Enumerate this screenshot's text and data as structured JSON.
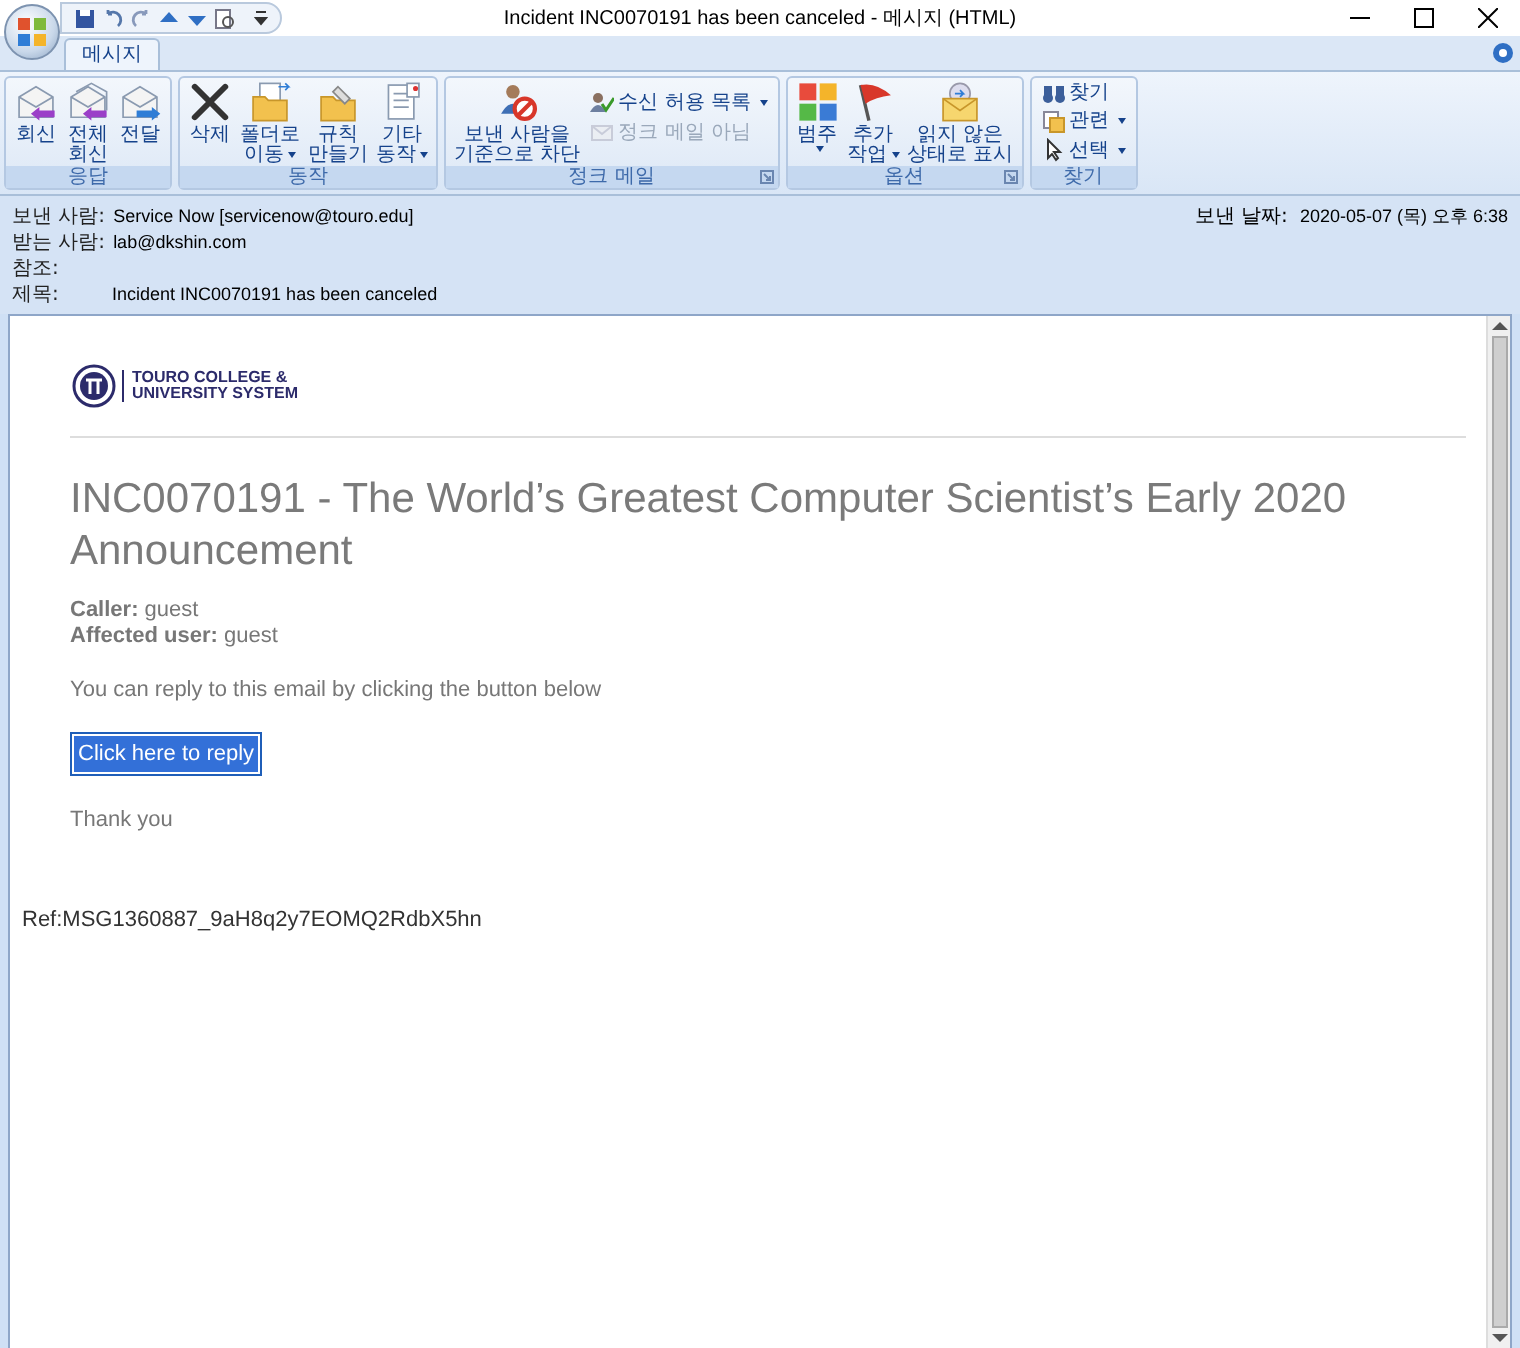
{
  "window": {
    "title": "Incident INC0070191 has been canceled - 메시지 (HTML)"
  },
  "quick_access": [
    {
      "kind": "save"
    },
    {
      "kind": "undo"
    },
    {
      "kind": "redo"
    },
    {
      "kind": "up"
    },
    {
      "kind": "down"
    },
    {
      "kind": "preview"
    }
  ],
  "tabs": [
    {
      "label": "메시지",
      "selected": true
    }
  ],
  "ribbon": [
    {
      "label": "응답",
      "buttons": [
        {
          "kind": "reply",
          "lines": [
            "회신"
          ]
        },
        {
          "kind": "replyall",
          "lines": [
            "전체",
            "회신"
          ]
        },
        {
          "kind": "forward",
          "lines": [
            "전달"
          ]
        }
      ]
    },
    {
      "label": "동작",
      "buttons": [
        {
          "kind": "delete",
          "lines": [
            "삭제"
          ]
        },
        {
          "kind": "move",
          "lines": [
            "폴더로",
            "이동"
          ],
          "dropdown": true
        },
        {
          "kind": "rule",
          "lines": [
            "규칙",
            "만들기"
          ]
        },
        {
          "kind": "other",
          "lines": [
            "기타",
            "동작"
          ],
          "dropdown": true
        }
      ]
    },
    {
      "label": "정크 메일",
      "launcher": true,
      "buttons": [
        {
          "kind": "block",
          "lines": [
            "보낸 사람을",
            "기준으로 차단"
          ]
        }
      ],
      "small": [
        {
          "kind": "safe",
          "label": "수신 허용 목록",
          "dropdown": true,
          "disabled": false
        },
        {
          "kind": "notjunk",
          "label": "정크 메일 아님",
          "disabled": true
        }
      ]
    },
    {
      "label": "옵션",
      "launcher": true,
      "buttons": [
        {
          "kind": "category",
          "lines": [
            "범주"
          ],
          "dropdown": true
        },
        {
          "kind": "flag",
          "lines": [
            "추가",
            "작업"
          ],
          "dropdown": true
        },
        {
          "kind": "unread",
          "lines": [
            "읽지 않은",
            "상태로 표시"
          ]
        }
      ]
    },
    {
      "label": "찾기",
      "small": [
        {
          "kind": "find",
          "label": "찾기",
          "disabled": false
        },
        {
          "kind": "related",
          "label": "관련",
          "dropdown": true,
          "disabled": false
        },
        {
          "kind": "select",
          "label": "선택",
          "dropdown": true,
          "disabled": false
        }
      ]
    }
  ],
  "header": {
    "fields": [
      {
        "label": "보낸 사람:",
        "value": "Service Now [servicenow@touro.edu]"
      },
      {
        "label": "받는 사람:",
        "value": "lab@dkshin.com"
      },
      {
        "label": "참조:"
      },
      {
        "label": "제목:",
        "value": "Incident INC0070191 has been canceled"
      }
    ],
    "date_label": "보낸 날짜:",
    "date": "2020-05-07 (목) 오후 6:38"
  },
  "email": {
    "logo_lines": [
      "TOURO COLLEGE &",
      "UNIVERSITY SYSTEM"
    ],
    "heading": "INC0070191 - The World’s Greatest Computer Scientist’s Early 2020 Announcement",
    "details": [
      "**Caller:** guest",
      "**Affected user:** guest"
    ],
    "prompt": "You can reply to this email by clicking the button below",
    "reply_link": {
      "label": "Click here to reply",
      "selected": true
    },
    "closing": "Thank you",
    "ref": "Ref:MSG1360887_9aH8q2y7EOMQ2RdbX5hn"
  }
}
